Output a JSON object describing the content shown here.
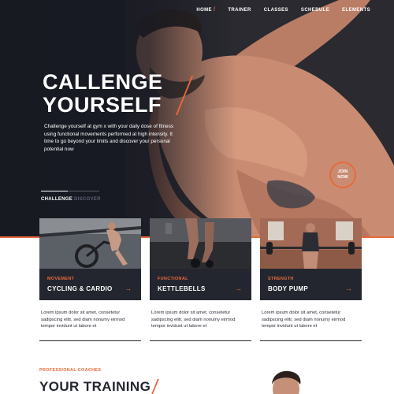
{
  "nav": {
    "items": [
      {
        "label": "HOME",
        "slash": "/"
      },
      {
        "label": "TRAINER",
        "slash": ""
      },
      {
        "label": "CLASSES",
        "slash": ""
      },
      {
        "label": "SCHEDULE",
        "slash": ""
      },
      {
        "label": "ELEMENTS",
        "slash": ""
      }
    ]
  },
  "hero": {
    "headline_line1": "CALLENGE",
    "headline_line2": "YOURSELF",
    "intro": "Challenge yourself at gym x with your daily dose of fitness using functional movements performed at high intensity. It time to go beyond your limits and discover your personal potential now",
    "join_line1": "JOIN",
    "join_line2": "NOW",
    "tabs": [
      {
        "label": "CHALLENGE",
        "active": true
      },
      {
        "label": "DISCOVER",
        "active": false
      }
    ]
  },
  "cards": [
    {
      "category": "MOVEMENT",
      "title": "CYCLING & CARDIO",
      "arrow": "→",
      "description": "Lorem ipsum dolor sit amet, consetetur sadipscing elitr, sed diam nonumy eirmod tempor invidunt ut labore et"
    },
    {
      "category": "FUNCTIONAL",
      "title": "KETTLEBELLS",
      "arrow": "→",
      "description": "Lorem ipsum dolor sit amet, consetetur sadipscing elitr, sed diam nonumy eirmod tempor invidunt ut labore et"
    },
    {
      "category": "STRENGTH",
      "title": "BODY PUMP",
      "arrow": "→",
      "description": "Lorem ipsum dolor sit amet, consetetur sadipscing elitr, sed diam nonumy eirmod tempor invidunt ut labore et"
    }
  ],
  "coaches": {
    "label": "PROFESSIONAL COACHES",
    "heading": "YOUR TRAINING"
  },
  "colors": {
    "accent": "#e86a3a",
    "dark": "#24262f",
    "hero_bg": "#1b1d26"
  }
}
